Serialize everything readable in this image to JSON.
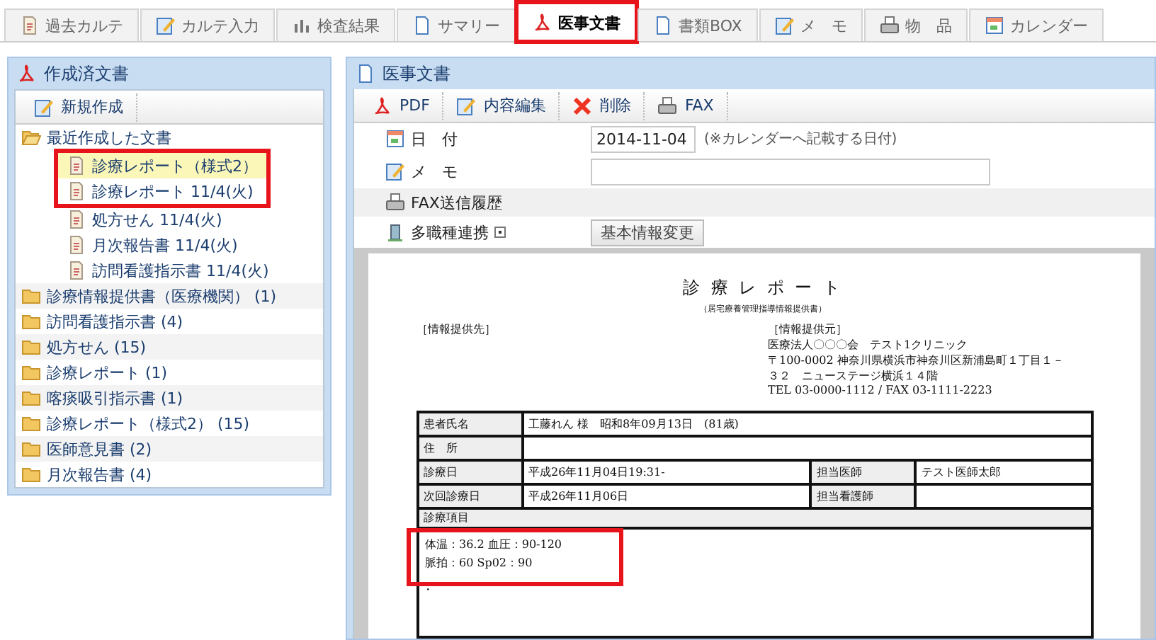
{
  "tabs": [
    {
      "label": "過去カルテ",
      "selected": false,
      "highlighted": false
    },
    {
      "label": "カルテ入力",
      "selected": false,
      "highlighted": false
    },
    {
      "label": "検査結果",
      "selected": false,
      "highlighted": false
    },
    {
      "label": "サマリー",
      "selected": false,
      "highlighted": false
    },
    {
      "label": "医事文書",
      "selected": true,
      "highlighted": true
    },
    {
      "label": "書類BOX",
      "selected": false,
      "highlighted": false
    },
    {
      "label": "メ　モ",
      "selected": false,
      "highlighted": false
    },
    {
      "label": "物　品",
      "selected": false,
      "highlighted": false
    },
    {
      "label": "カレンダー",
      "selected": false,
      "highlighted": false
    }
  ],
  "sidebar": {
    "title": "作成済文書",
    "new_button": "新規作成",
    "tree": [
      {
        "label": "最近作成した文書",
        "expanded": true,
        "children": [
          {
            "label": "診療レポート（様式2）",
            "selected": true,
            "highlighted": true
          },
          {
            "label": "診療レポート 11/4(火)",
            "selected": false,
            "highlighted": true
          },
          {
            "label": "処方せん 11/4(火)",
            "selected": false,
            "highlighted": false
          },
          {
            "label": "月次報告書 11/4(火)",
            "selected": false,
            "highlighted": false
          },
          {
            "label": "訪問看護指示書 11/4(火)",
            "selected": false,
            "highlighted": false
          }
        ]
      },
      {
        "label": "診療情報提供書（医療機関） (1)",
        "expanded": false
      },
      {
        "label": "訪問看護指示書 (4)",
        "expanded": false
      },
      {
        "label": "処方せん (15)",
        "expanded": false
      },
      {
        "label": "診療レポート (1)",
        "expanded": false
      },
      {
        "label": "喀痰吸引指示書 (1)",
        "expanded": false
      },
      {
        "label": "診療レポート（様式2） (15)",
        "expanded": false
      },
      {
        "label": "医師意見書 (2)",
        "expanded": false
      },
      {
        "label": "月次報告書 (4)",
        "expanded": false
      }
    ]
  },
  "main": {
    "title": "医事文書",
    "toolbar": [
      "PDF",
      "内容編集",
      "削除",
      "FAX"
    ],
    "form": {
      "date_label": "日　付",
      "date_value": "2014-11-04",
      "date_note": "(※カレンダーへ記載する日付)",
      "memo_label": "メ　モ",
      "fax_history": "FAX送信履歴",
      "collab_label": "多職種連携",
      "collab_button": "基本情報変更"
    },
    "document": {
      "title": "診 療 レ ポ ー ト",
      "subtitle": "（居宅療養管理指導情報提供書）",
      "to_label": "［情報提供先］",
      "from_label": "［情報提供元］",
      "from_lines": [
        "医療法人〇〇〇会　テスト1クリニック",
        "〒100-0002 神奈川県横浜市神奈川区新浦島町１丁目１－",
        "３２　ニューステージ横浜１４階",
        "TEL 03-0000-1112 / FAX 03-1111-2223"
      ],
      "rows": [
        {
          "kind": "wide",
          "label": "患者氏名",
          "value": "工藤れん 様　昭和8年09月13日　(81歳)"
        },
        {
          "kind": "wide",
          "label": "住　所"
        },
        {
          "kind": "split",
          "label": "診療日",
          "value": "平成26年11月04日19:31-",
          "label_2": "担当医師",
          "value_2": "テスト医師太郎"
        },
        {
          "kind": "split",
          "label": "次回診療日",
          "value": "平成26年11月06日",
          "label_2": "担当看護師"
        }
      ],
      "section_title": "診療項目",
      "vitals": [
        "体温：36.2 血圧：90-120",
        "脈拍：60 Sp02：90"
      ],
      "vitals_highlighted": true,
      "trailing": "・"
    }
  }
}
